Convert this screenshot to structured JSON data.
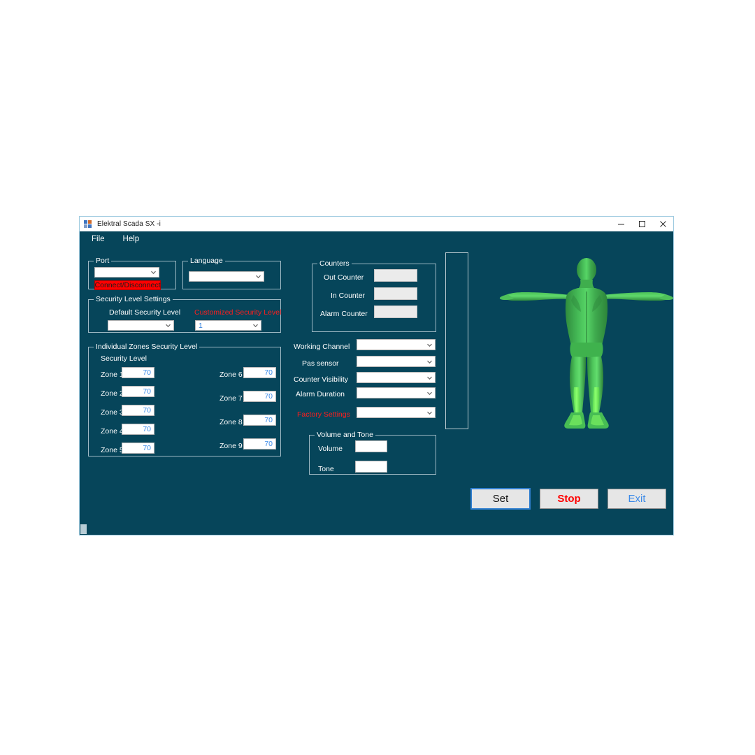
{
  "window": {
    "title": "Elektral Scada SX -i",
    "icon": "vs-form-icon",
    "background_color": "#06455a",
    "controls": [
      {
        "name": "minimize-button",
        "glyph": "minimize-icon"
      },
      {
        "name": "maximize-button",
        "glyph": "maximize-icon"
      },
      {
        "name": "close-button",
        "glyph": "close-icon"
      }
    ]
  },
  "menubar": {
    "items": [
      {
        "label": "File"
      },
      {
        "label": "Help"
      }
    ]
  },
  "port_group": {
    "title": "Port",
    "combo_value": "",
    "connect_button": "Connect/Disconnect"
  },
  "language_group": {
    "title": "Language",
    "combo_value": ""
  },
  "security_level_settings": {
    "title": "Security Level Settings",
    "default_label": "Default Security Level",
    "default_value": "",
    "customized_label": "Customized Security Level",
    "customized_value": "1"
  },
  "individual_zones": {
    "title": "Individual Zones Security Level",
    "subtitle": "Security Level",
    "left_column": [
      {
        "label": "Zone 1",
        "value": "70"
      },
      {
        "label": "Zone 2",
        "value": "70"
      },
      {
        "label": "Zone 3",
        "value": "70"
      },
      {
        "label": "Zone 4",
        "value": "70"
      },
      {
        "label": "Zone 5",
        "value": "70"
      }
    ],
    "right_column": [
      {
        "label": "Zone 6",
        "value": "70"
      },
      {
        "label": "Zone 7",
        "value": "70"
      },
      {
        "label": "Zone 8",
        "value": "70"
      },
      {
        "label": "Zone 9",
        "value": "70"
      }
    ]
  },
  "counters_group": {
    "title": "Counters",
    "rows": [
      {
        "label": "Out Counter",
        "value": ""
      },
      {
        "label": "In Counter",
        "value": ""
      },
      {
        "label": "Alarm Counter",
        "value": ""
      }
    ]
  },
  "settings_dropdowns": [
    {
      "label": "Working Channel",
      "value": "",
      "red": false
    },
    {
      "label": "Pas sensor",
      "value": "",
      "red": false
    },
    {
      "label": "Counter Visibility",
      "value": "",
      "red": false
    },
    {
      "label": "Alarm Duration",
      "value": "",
      "red": false
    },
    {
      "label": "Factory Settings",
      "value": "",
      "red": true
    }
  ],
  "volume_tone_group": {
    "title": "Volume and Tone",
    "rows": [
      {
        "label": "Volume",
        "value": ""
      },
      {
        "label": "Tone",
        "value": ""
      }
    ]
  },
  "action_buttons": [
    {
      "label": "Set",
      "color": "#111111"
    },
    {
      "label": "Stop",
      "color": "#ff0000"
    },
    {
      "label": "Exit",
      "color": "#3b8ae8"
    }
  ],
  "body_model": {
    "name": "human-body-rear-view",
    "fill_color": "#3ca54a",
    "highlight_color": "#6ee84f"
  }
}
